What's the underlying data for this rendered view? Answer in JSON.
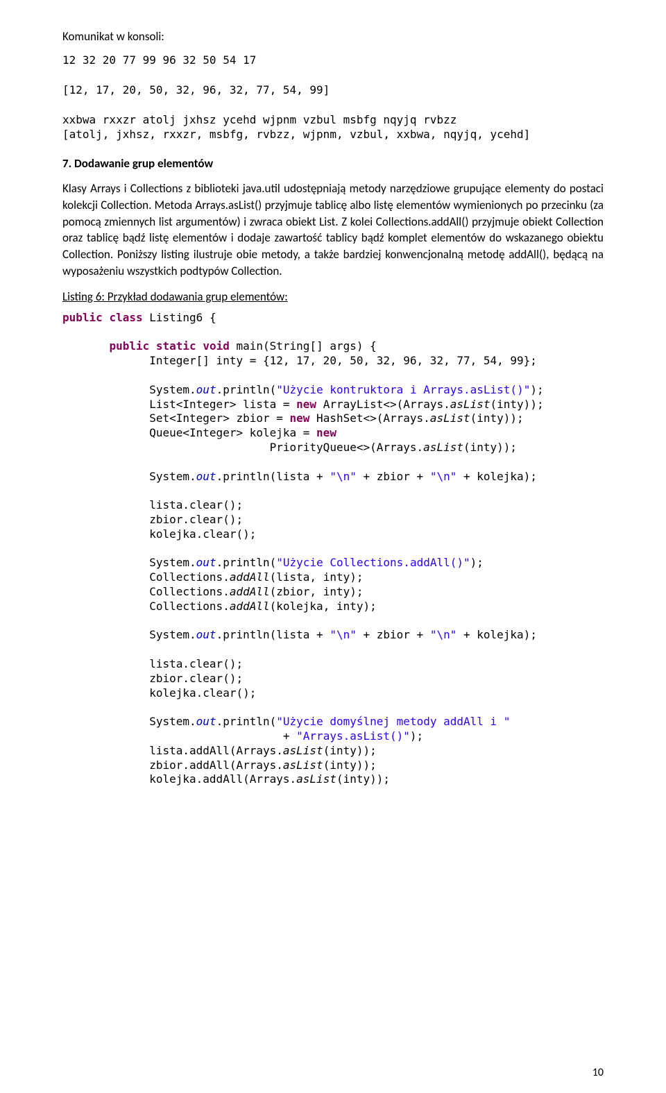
{
  "console": {
    "header": "Komunikat w konsoli:",
    "lines": [
      "12 32 20 77 99 96 32 50 54 17",
      "",
      "[12, 17, 20, 50, 32, 96, 32, 77, 54, 99]",
      "",
      "xxbwa rxxzr atolj jxhsz ycehd wjpnm vzbul msbfg nqyjq rvbzz",
      "[atolj, jxhsz, rxxzr, msbfg, rvbzz, wjpnm, vzbul, xxbwa, nqyjq, ycehd]"
    ]
  },
  "section": {
    "heading": "7.  Dodawanie grup elementów",
    "para": "Klasy Arrays i Collections z biblioteki  java.util udostępniają metody narzędziowe grupujące elementy do postaci kolekcji Collection. Metoda Arrays.asList() przyjmuje tablicę albo listę elementów wymienionych po przecinku (za pomocą zmiennych list argumentów) i zwraca obiekt List. Z kolei Collections.addAll() przyjmuje obiekt Collection oraz tablicę bądź listę elementów i dodaje zawartość tablicy bądź komplet elementów do wskazanego obiektu Collection. Poniższy listing ilustruje obie metody, a także bardziej konwencjonalną metodę addAll(), będącą na wyposażeniu wszystkich podtypów Collection.",
    "listing_label": "Listing 6: Przykład dodawania grup elementów:"
  },
  "code": {
    "kw_public": "public",
    "kw_class": "class",
    "kw_static": "static",
    "kw_void": "void",
    "kw_new": "new",
    "class_name": "Listing6",
    "main_sig_1": " main(String[] args) {",
    "inty_decl": "             Integer[] inty = {12, 17, 20, 50, 32, 96, 32, 77, 54, 99};",
    "sys": "System.",
    "out": "out",
    "print_open": ".println(",
    "str_uzycie1": "\"Użycie kontruktora i Arrays.asList()\"",
    "close_paren": ");",
    "lista_decl1": "             List<Integer> lista = ",
    "lista_decl2": " ArrayList<>(Arrays.",
    "aslist": "asList",
    "aslist_arg": "(inty));",
    "zbior_decl1": "             Set<Integer> zbior = ",
    "zbior_decl2": " HashSet<>(Arrays.",
    "kolejka_decl1": "             Queue<Integer> kolejka = ",
    "kolejka_decl2": "                               PriorityQueue<>(Arrays.",
    "print_concat1": "             System.",
    "print_concat2": ".println(lista + ",
    "str_nl": "\"\\n\"",
    "plus_zbior": " + zbior + ",
    "plus_kolejka": " + kolejka);",
    "lista_clear": "             lista.clear();",
    "zbior_clear": "             zbior.clear();",
    "kolejka_clear": "             kolejka.clear();",
    "str_uzycie2": "\"Użycie Collections.addAll()\"",
    "coll_addall": "addAll",
    "coll_lista": "             Collections.",
    "coll_lista_arg": "(lista, inty);",
    "coll_zbior_arg": "(zbior, inty);",
    "coll_kolejka_arg": "(kolejka, inty);",
    "str_uzycie3a": "\"Użycie domyślnej metody addAll i \"",
    "str_uzycie3b": "\"Arrays.asList()\"",
    "plus_indent": "                                 + ",
    "lista_addall": "             lista.addAll(Arrays.",
    "zbior_addall": "             zbior.addAll(Arrays.",
    "kolejka_addall": "             kolejka.addAll(Arrays.",
    "indent13": "             ",
    "indent7": "       "
  },
  "page_num": "10"
}
